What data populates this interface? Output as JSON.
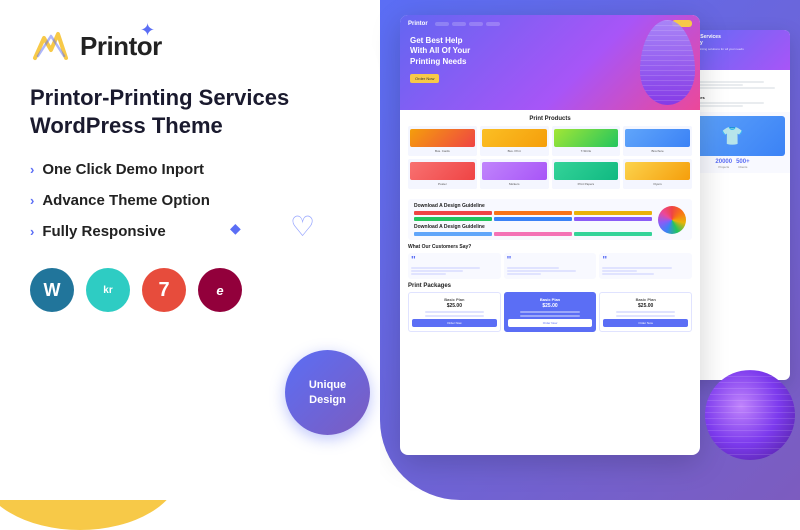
{
  "page": {
    "bg_color": "#ffffff",
    "accent_color": "#5b6ef5",
    "yellow_accent": "#f7c948"
  },
  "logo": {
    "text": "Printor",
    "icon_color": "#f7c948"
  },
  "theme": {
    "title_line1": "Printor-Printing Services",
    "title_line2": "WordPress Theme"
  },
  "features": [
    {
      "id": "feature-1",
      "label": "One Click Demo Inport"
    },
    {
      "id": "feature-2",
      "label": "Advance Theme Option"
    },
    {
      "id": "feature-3",
      "label": "Fully Responsive"
    }
  ],
  "plugins": [
    {
      "id": "wordpress",
      "symbol": "W",
      "label": "WordPress",
      "bg": "#21759b"
    },
    {
      "id": "kr",
      "symbol": "kr",
      "label": "Krating",
      "bg": "#2eccc3"
    },
    {
      "id": "7",
      "symbol": "7",
      "label": "7",
      "bg": "#e74c3c"
    },
    {
      "id": "elementor",
      "symbol": "e",
      "label": "Elementor",
      "bg": "#92003b"
    }
  ],
  "unique_badge": {
    "line1": "Unique",
    "line2": "Design"
  },
  "mockup": {
    "hero_title": "Get Best Help\nWith All Of Your\nPrinting Needs",
    "products_title": "Print Products",
    "products": [
      {
        "label": "Business Cards"
      },
      {
        "label": "Business Print"
      },
      {
        "label": "T-Shirts"
      },
      {
        "label": "Brochure"
      },
      {
        "label": "Poster"
      },
      {
        "label": "Stickers"
      },
      {
        "label": "Print Papers"
      },
      {
        "label": "Flyers"
      }
    ],
    "color_guide_title": "Download A Design Guideline",
    "testimonials_title": "What Our Customers Say?",
    "pricing": {
      "title": "Print Packages",
      "plans": [
        {
          "name": "Basic Plan",
          "price": "$25.00",
          "highlight": false
        },
        {
          "name": "Basic Plan",
          "price": "$25.00",
          "highlight": true
        },
        {
          "name": "Basic Plan",
          "price": "$25.00",
          "highlight": false
        }
      ]
    }
  },
  "stats": [
    {
      "number": "20000",
      "label": "Projects"
    },
    {
      "number": "500+",
      "label": "Clients"
    }
  ]
}
